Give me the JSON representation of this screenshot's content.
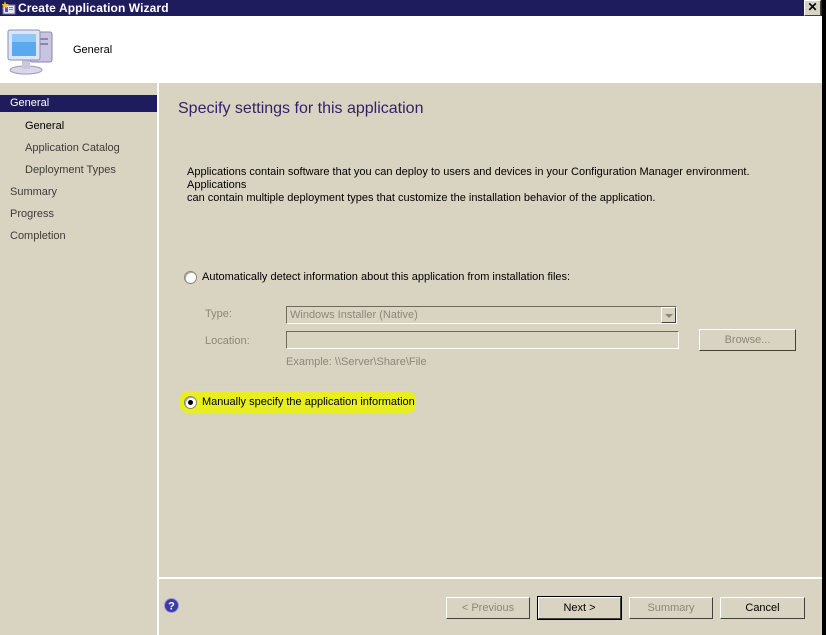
{
  "window": {
    "title": "Create Application Wizard",
    "close_label": "✕"
  },
  "header": {
    "title": "General",
    "icon": "computer-icon"
  },
  "sidebar": {
    "items": [
      {
        "label": "General",
        "level": "top",
        "active": true
      },
      {
        "label": "General",
        "level": "sub",
        "active": false
      },
      {
        "label": "Application Catalog",
        "level": "sub",
        "active": false
      },
      {
        "label": "Deployment Types",
        "level": "sub",
        "active": false
      },
      {
        "label": "Summary",
        "level": "top",
        "active": false
      },
      {
        "label": "Progress",
        "level": "top",
        "active": false
      },
      {
        "label": "Completion",
        "level": "top",
        "active": false
      }
    ]
  },
  "main": {
    "page_title": "Specify settings for this application",
    "description_line1": "Applications contain software that you can deploy to users and devices in your Configuration Manager environment. Applications",
    "description_line2": "can contain multiple deployment types that customize the installation behavior of the application.",
    "auto_detect": {
      "label": "Automatically detect information about this application from installation files:",
      "selected": false,
      "type_label": "Type:",
      "type_value": "Windows Installer (Native)",
      "location_label": "Location:",
      "location_value": "",
      "browse_label": "Browse...",
      "example": "Example: \\\\Server\\Share\\File"
    },
    "manual": {
      "label": "Manually specify the application information",
      "selected": true,
      "highlight_color": "#e8ee20"
    }
  },
  "footer": {
    "help_icon": "help-icon",
    "previous_label": "< Previous",
    "next_label": "Next >",
    "summary_label": "Summary",
    "cancel_label": "Cancel"
  },
  "colors": {
    "titlebar": "#1f1c5e",
    "background": "#d9d3c1",
    "page_title": "#31236b",
    "disabled_text": "#8c887a"
  }
}
